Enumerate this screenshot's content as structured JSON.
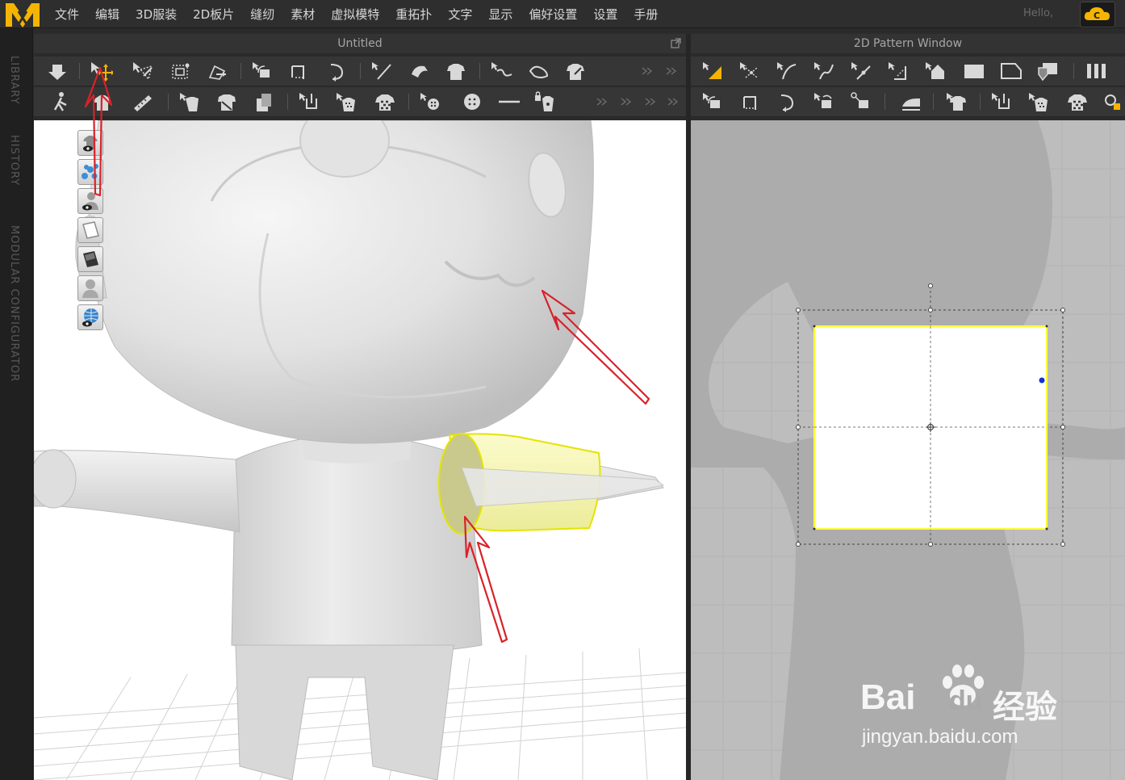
{
  "app": {
    "logo": "M",
    "logo_icon": "marvelous-logo-icon"
  },
  "menu": [
    "文件",
    "编辑",
    "3D服装",
    "2D板片",
    "缝纫",
    "素材",
    "虚拟模特",
    "重拓扑",
    "文字",
    "显示",
    "偏好设置",
    "设置",
    "手册"
  ],
  "user": {
    "greeting": "Hello,"
  },
  "side_tabs": [
    "LIBRARY",
    "HISTORY",
    "MODULAR CONFIGURATOR"
  ],
  "windows": {
    "left_title": "Untitled",
    "right_title": "2D Pattern Window"
  },
  "watermark": {
    "brand": "Bai",
    "brand2": "du",
    "cn": "经验",
    "url": "jingyan.baidu.com"
  },
  "colors": {
    "accent": "#f5b400",
    "selection": "#ffff33",
    "annotation_arrow": "#d9222a",
    "pin_dot": "#1133cc"
  }
}
